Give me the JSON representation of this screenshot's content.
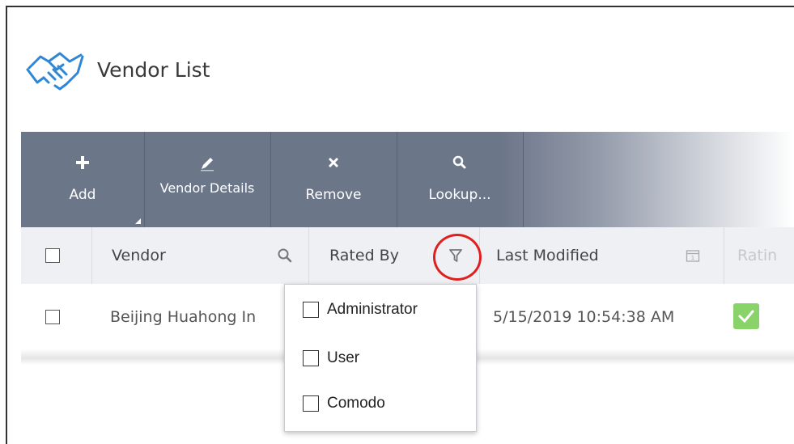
{
  "page": {
    "title": "Vendor List"
  },
  "toolbar": {
    "add": "Add",
    "vendor_details": "Vendor Details",
    "remove": "Remove",
    "lookup": "Lookup..."
  },
  "columns": {
    "vendor": "Vendor",
    "rated_by": "Rated By",
    "last_modified": "Last Modified",
    "rating": "Ratin"
  },
  "rows": [
    {
      "vendor": "Beijing Huahong In",
      "last_modified": "5/15/2019 10:54:38 AM"
    }
  ],
  "filter_menu": {
    "options": [
      "Administrator",
      "User",
      "Comodo"
    ]
  },
  "colors": {
    "toolbar": "#6c7689",
    "accent_circle": "#e02020",
    "rating_ok": "#8ad26a",
    "icon": "#2f86d6"
  }
}
